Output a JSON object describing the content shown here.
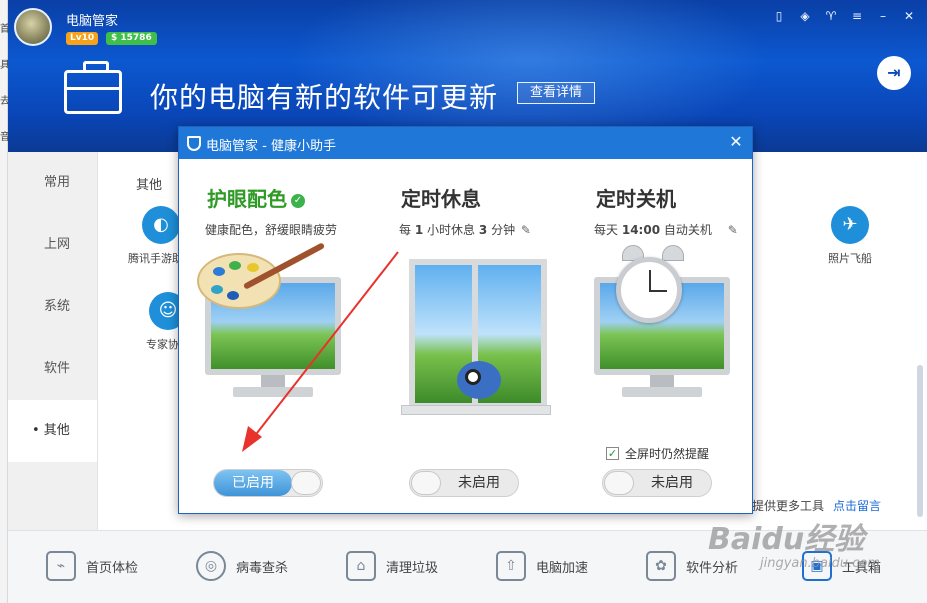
{
  "app": {
    "title": "电脑管家",
    "level": "Lv10",
    "coins": "$ 15786"
  },
  "header": {
    "headline": "你的电脑有新的软件可更新",
    "detail_button": "查看详情"
  },
  "sidebar": {
    "items": [
      {
        "label": "常用"
      },
      {
        "label": "上网"
      },
      {
        "label": "系统"
      },
      {
        "label": "软件"
      },
      {
        "label": "• 其他"
      }
    ]
  },
  "content": {
    "tab": "其他",
    "tools": [
      {
        "label": "腾讯手游助手",
        "icon": "gamepad-icon"
      },
      {
        "label": "专家协助",
        "icon": "expert-icon"
      },
      {
        "label": "照片飞船",
        "icon": "spaceship-icon"
      }
    ],
    "more_text": "提供更多工具",
    "more_link": "点击留言"
  },
  "bottom_nav": [
    {
      "label": "首页体检",
      "icon": "checkup-icon"
    },
    {
      "label": "病毒查杀",
      "icon": "virus-scan-icon"
    },
    {
      "label": "清理垃圾",
      "icon": "broom-icon"
    },
    {
      "label": "电脑加速",
      "icon": "rocket-icon"
    },
    {
      "label": "软件分析",
      "icon": "software-icon"
    },
    {
      "label": "工具箱",
      "icon": "toolbox-icon"
    }
  ],
  "dialog": {
    "title": "电脑管家 - 健康小助手",
    "features": [
      {
        "title": "护眼配色",
        "enabled": true,
        "description": "健康配色，舒缓眼睛疲劳",
        "toggle_label": "已启用"
      },
      {
        "title": "定时休息",
        "enabled": false,
        "desc_prefix": "每",
        "desc_hours": "1",
        "desc_mid": "小时休息",
        "desc_minutes": "3",
        "desc_suffix": "分钟",
        "toggle_label": "未启用"
      },
      {
        "title": "定时关机",
        "enabled": false,
        "desc_prefix": "每天",
        "desc_time": "14:00",
        "desc_suffix": "自动关机",
        "fullscreen_option": "全屏时仍然提醒",
        "fullscreen_checked": true,
        "toggle_label": "未启用"
      }
    ]
  },
  "watermark": {
    "text": "Baidu经验",
    "sub": "jingyan.baidu.com"
  },
  "colors": {
    "header_blue": "#0c58d0",
    "dialog_title_blue": "#1f78d8",
    "enabled_green": "#2f9a25",
    "arrow_red": "#e8322b"
  }
}
